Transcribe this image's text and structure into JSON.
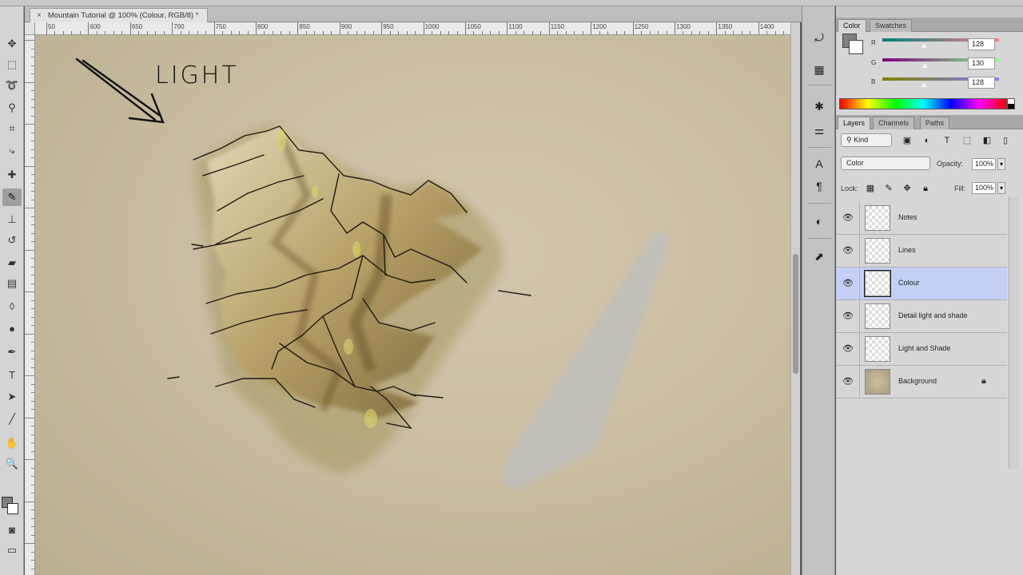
{
  "document": {
    "tab_title": "Mountain Tutorial @ 100% (Colour, RGB/8) *",
    "close_glyph": "×"
  },
  "ruler": {
    "labels": [
      "50",
      "600",
      "650",
      "700",
      "750",
      "800",
      "850",
      "900",
      "950",
      "1000",
      "1050",
      "1100",
      "1150",
      "1200",
      "1250",
      "1300",
      "1350",
      "1400"
    ]
  },
  "canvas": {
    "annotation_text": "LIGHT",
    "paper_color": "#c9bea1"
  },
  "toolbar": {
    "tools": [
      {
        "name": "move-tool-icon",
        "glyph": "✥"
      },
      {
        "name": "marquee-tool-icon",
        "glyph": "⬚"
      },
      {
        "name": "lasso-tool-icon",
        "glyph": "➰"
      },
      {
        "name": "quick-select-tool-icon",
        "glyph": "⚲"
      },
      {
        "name": "crop-tool-icon",
        "glyph": "⌗"
      },
      {
        "name": "eyedropper-tool-icon",
        "glyph": "⤷"
      },
      {
        "name": "healing-brush-tool-icon",
        "glyph": "✚"
      },
      {
        "name": "brush-tool-icon",
        "glyph": "✎"
      },
      {
        "name": "clone-stamp-tool-icon",
        "glyph": "⊥"
      },
      {
        "name": "history-brush-tool-icon",
        "glyph": "↺"
      },
      {
        "name": "eraser-tool-icon",
        "glyph": "▰"
      },
      {
        "name": "gradient-tool-icon",
        "glyph": "▤"
      },
      {
        "name": "blur-tool-icon",
        "glyph": "◊"
      },
      {
        "name": "dodge-tool-icon",
        "glyph": "●"
      },
      {
        "name": "pen-tool-icon",
        "glyph": "✒"
      },
      {
        "name": "type-tool-icon",
        "glyph": "T"
      },
      {
        "name": "path-select-tool-icon",
        "glyph": "➤"
      },
      {
        "name": "line-tool-icon",
        "glyph": "╱"
      },
      {
        "name": "hand-tool-icon",
        "glyph": "✋"
      },
      {
        "name": "zoom-tool-icon",
        "glyph": "🔍"
      }
    ],
    "extras": [
      {
        "name": "quick-mask-icon",
        "glyph": "◙"
      },
      {
        "name": "screen-mode-icon",
        "glyph": "▭"
      }
    ],
    "fg_color": "#808080",
    "bg_color": "#ffffff"
  },
  "dock": {
    "icons": [
      {
        "name": "history-panel-icon",
        "glyph": "⤾"
      },
      {
        "name": "swatches-dock-icon",
        "glyph": "▦"
      },
      {
        "name": "brush-presets-icon",
        "glyph": "✱"
      },
      {
        "name": "adjustments-icon",
        "glyph": "⚌"
      },
      {
        "name": "character-panel-icon",
        "glyph": "A"
      },
      {
        "name": "paragraph-panel-icon",
        "glyph": "¶"
      },
      {
        "name": "styles-icon",
        "glyph": "◐"
      },
      {
        "name": "navigator-icon",
        "glyph": "⬈"
      }
    ]
  },
  "color_panel": {
    "tabs": [
      "Color",
      "Swatches"
    ],
    "channels": [
      {
        "label": "R",
        "value": "128"
      },
      {
        "label": "G",
        "value": "130"
      },
      {
        "label": "B",
        "value": "128"
      }
    ]
  },
  "layers_panel": {
    "tabs": [
      "Layers",
      "Channels",
      "Paths"
    ],
    "kind_label": "Kind",
    "blend_mode": "Color",
    "opacity_label": "Opacity:",
    "opacity_value": "100%",
    "lock_label": "Lock:",
    "fill_label": "Fill:",
    "fill_value": "100%",
    "layers": [
      {
        "name": "Notes",
        "selected": false
      },
      {
        "name": "Lines",
        "selected": false
      },
      {
        "name": "Colour",
        "selected": true
      },
      {
        "name": "Detail light and shade",
        "selected": false
      },
      {
        "name": "Light and Shade",
        "selected": false
      },
      {
        "name": "Background",
        "selected": false,
        "locked": true
      }
    ]
  }
}
